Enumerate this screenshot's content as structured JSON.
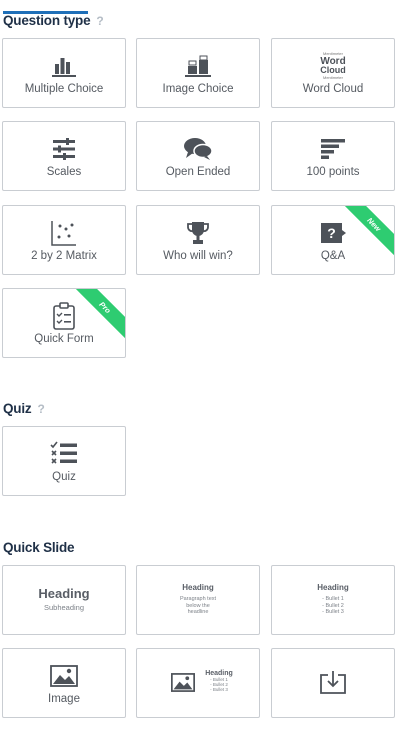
{
  "sections": {
    "question_type": {
      "title": "Question type",
      "help": "?",
      "cards": [
        {
          "label": "Multiple Choice",
          "icon": "bar-chart-icon"
        },
        {
          "label": "Image Choice",
          "icon": "image-choice-icon"
        },
        {
          "label": "Word Cloud",
          "icon": "word-cloud-icon"
        },
        {
          "label": "Scales",
          "icon": "sliders-icon"
        },
        {
          "label": "Open Ended",
          "icon": "speech-bubbles-icon"
        },
        {
          "label": "100 points",
          "icon": "horizontal-bars-icon"
        },
        {
          "label": "2 by 2 Matrix",
          "icon": "scatter-matrix-icon"
        },
        {
          "label": "Who will win?",
          "icon": "trophy-icon"
        },
        {
          "label": "Q&A",
          "icon": "question-bubble-icon",
          "badge": "New"
        },
        {
          "label": "Quick Form",
          "icon": "clipboard-checklist-icon",
          "badge": "Pro"
        }
      ],
      "word_cloud_art": {
        "line1": "Mentimeter",
        "word1": "Word",
        "word2": "Cloud",
        "line2": "Mentimeter"
      }
    },
    "quiz": {
      "title": "Quiz",
      "help": "?",
      "cards": [
        {
          "label": "Quiz",
          "icon": "quiz-checklist-icon"
        }
      ]
    },
    "quick_slide": {
      "title": "Quick Slide",
      "heading_card": {
        "heading": "Heading",
        "subheading": "Subheading"
      },
      "paragraph_card": {
        "heading": "Heading",
        "text": "Paragraph text below the headline"
      },
      "bullets_card": {
        "heading": "Heading",
        "bullets": [
          "- Bullet 1",
          "- Bullet 2",
          "- Bullet 3"
        ]
      },
      "image_card": {
        "label": "Image",
        "icon": "image-icon"
      },
      "image_bullets_card": {
        "heading": "Heading",
        "bullets": [
          "- Bullet 1",
          "- Bullet 2",
          "- Bullet 3"
        ],
        "icon": "image-icon"
      },
      "import_card": {
        "icon": "import-icon"
      }
    }
  },
  "colors": {
    "accent": "#1f6fb8",
    "badge": "#2ecc71",
    "icon": "#4d5259"
  }
}
